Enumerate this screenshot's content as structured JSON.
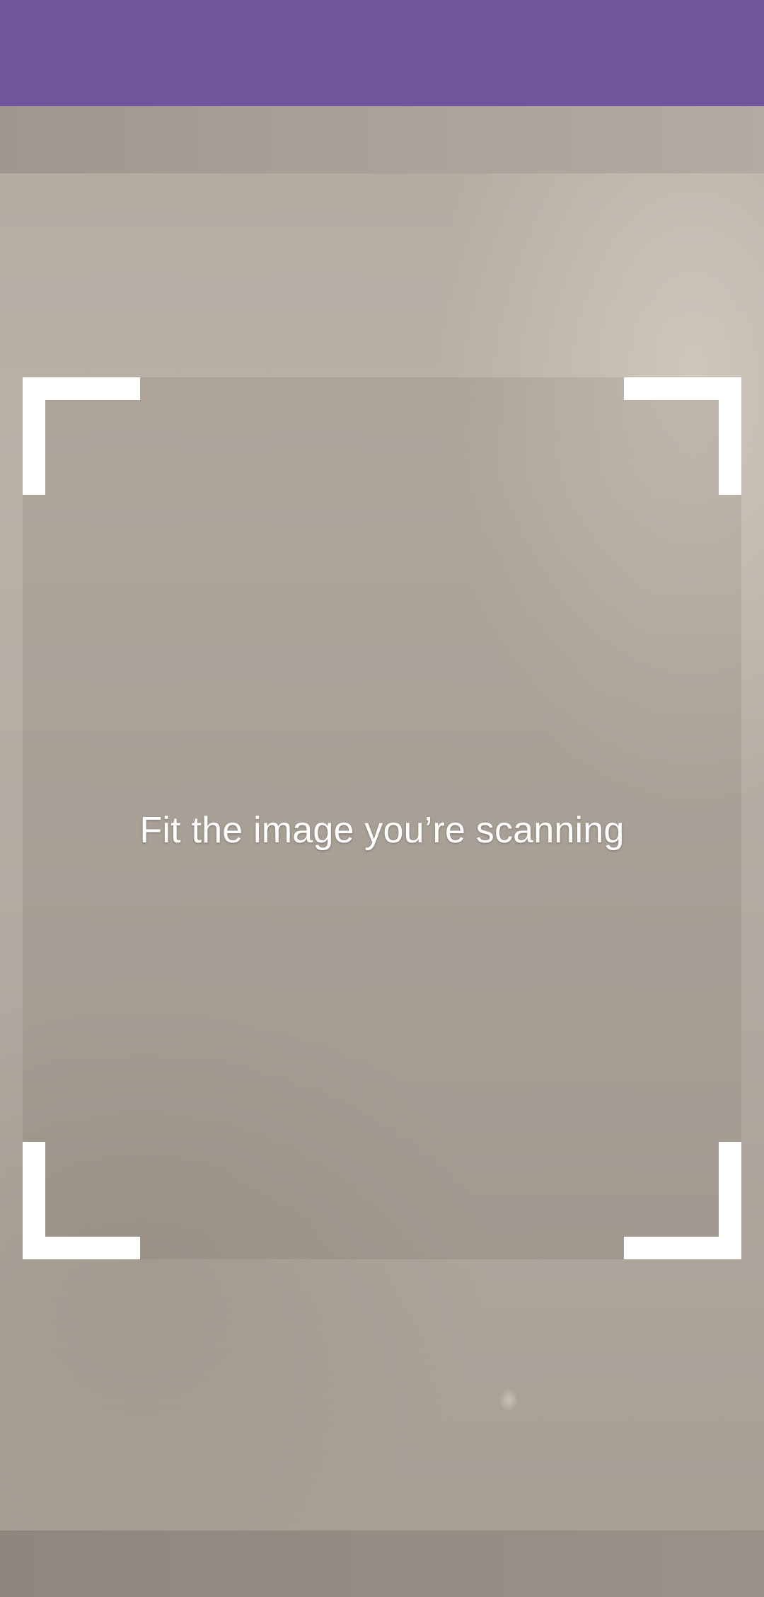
{
  "status_bar": {
    "color": "#6f559c"
  },
  "scanner": {
    "instruction": "Fit the image you’re scanning",
    "frame_corner_color": "#ffffff"
  }
}
